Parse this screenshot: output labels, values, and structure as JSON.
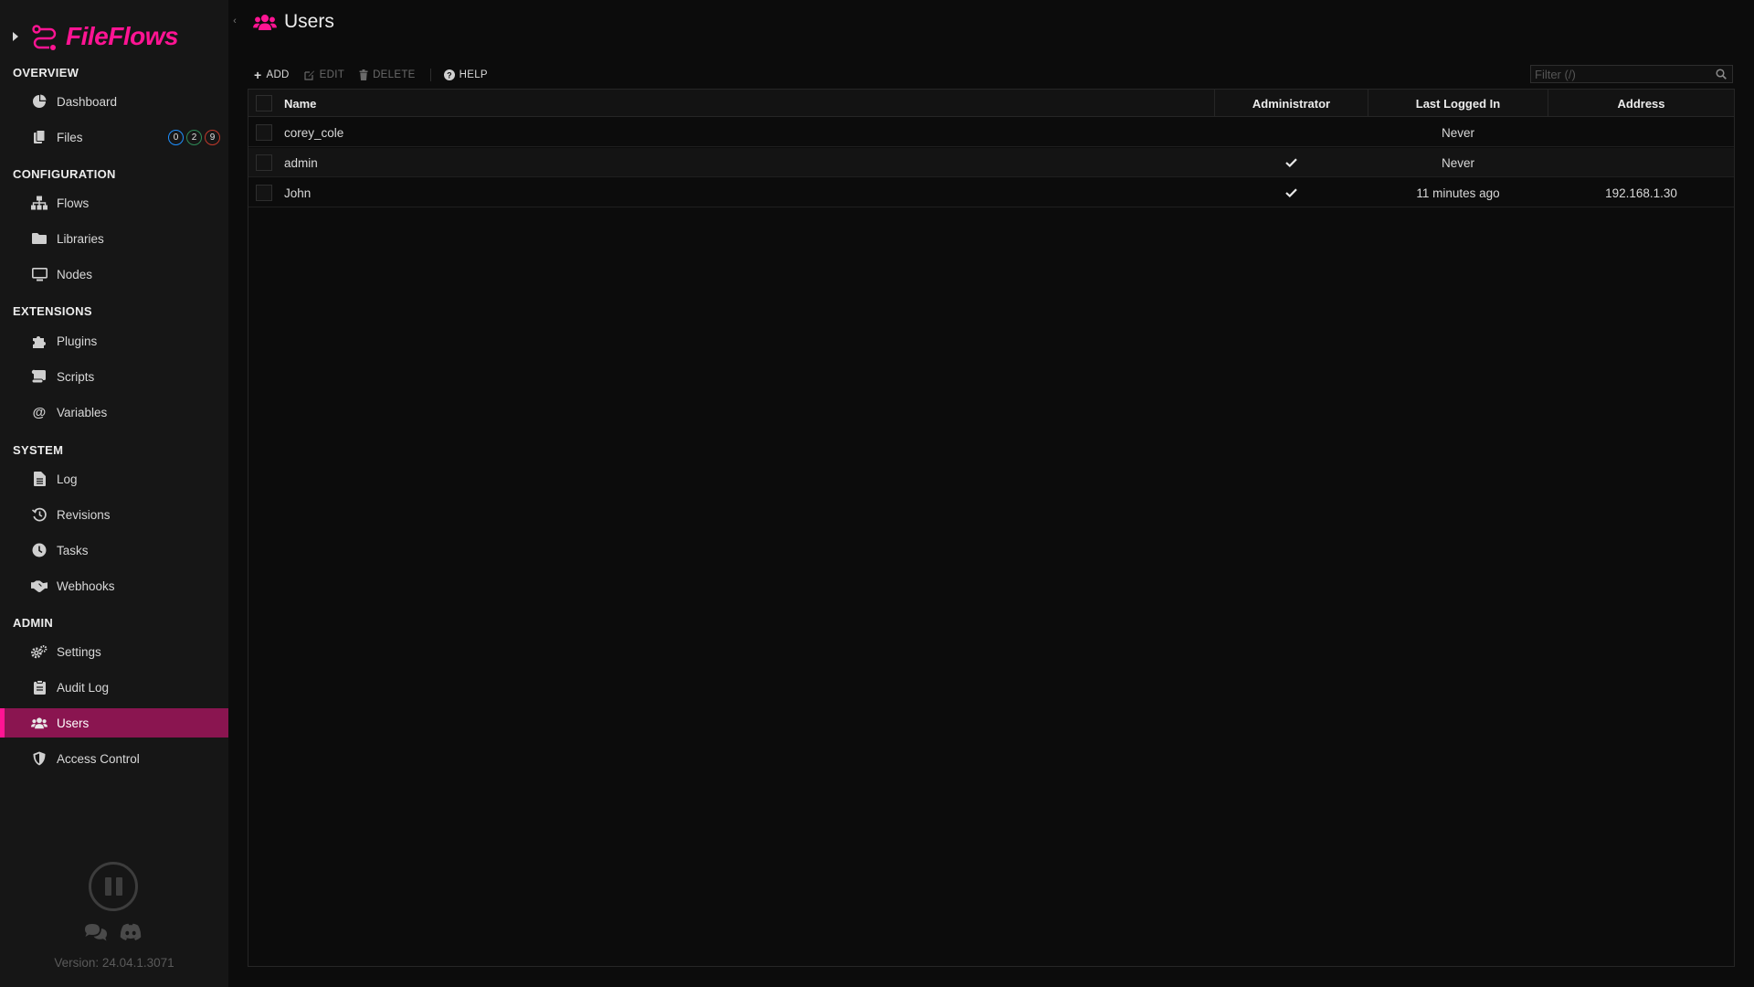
{
  "app": {
    "name": "FileFlows",
    "version": "Version: 24.04.1.3071"
  },
  "sidebar": {
    "sections": [
      {
        "title": "OVERVIEW"
      },
      {
        "title": "CONFIGURATION"
      },
      {
        "title": "EXTENSIONS"
      },
      {
        "title": "SYSTEM"
      },
      {
        "title": "ADMIN"
      }
    ],
    "items": [
      {
        "label": "Dashboard",
        "icon": "dashboard-icon"
      },
      {
        "label": "Files",
        "icon": "files-icon"
      },
      {
        "label": "Flows",
        "icon": "flows-icon"
      },
      {
        "label": "Libraries",
        "icon": "folder-icon"
      },
      {
        "label": "Nodes",
        "icon": "monitor-icon"
      },
      {
        "label": "Plugins",
        "icon": "puzzle-icon"
      },
      {
        "label": "Scripts",
        "icon": "scroll-icon"
      },
      {
        "label": "Variables",
        "icon": "at-icon"
      },
      {
        "label": "Log",
        "icon": "file-icon"
      },
      {
        "label": "Revisions",
        "icon": "history-icon"
      },
      {
        "label": "Tasks",
        "icon": "clock-icon"
      },
      {
        "label": "Webhooks",
        "icon": "handshake-icon"
      },
      {
        "label": "Settings",
        "icon": "gears-icon"
      },
      {
        "label": "Audit Log",
        "icon": "clipboard-icon"
      },
      {
        "label": "Users",
        "icon": "users-icon",
        "active": true
      },
      {
        "label": "Access Control",
        "icon": "shield-icon"
      }
    ],
    "file_badges": [
      {
        "value": "0",
        "color": "#1e90ff"
      },
      {
        "value": "2",
        "color": "#2e8b57"
      },
      {
        "value": "9",
        "color": "#c0392b"
      }
    ]
  },
  "page": {
    "title": "Users"
  },
  "toolbar": {
    "add": "ADD",
    "edit": "EDIT",
    "delete": "DELETE",
    "help": "HELP"
  },
  "filter": {
    "placeholder": "Filter (/)",
    "value": ""
  },
  "table": {
    "columns": {
      "name": "Name",
      "admin": "Administrator",
      "last": "Last Logged In",
      "address": "Address"
    },
    "rows": [
      {
        "name": "corey_cole",
        "admin": false,
        "last": "Never",
        "address": ""
      },
      {
        "name": "admin",
        "admin": true,
        "last": "Never",
        "address": ""
      },
      {
        "name": "John",
        "admin": true,
        "last": "11 minutes ago",
        "address": "192.168.1.30"
      }
    ]
  },
  "colors": {
    "accent": "#ff1493",
    "active_bg": "#8a1550"
  }
}
